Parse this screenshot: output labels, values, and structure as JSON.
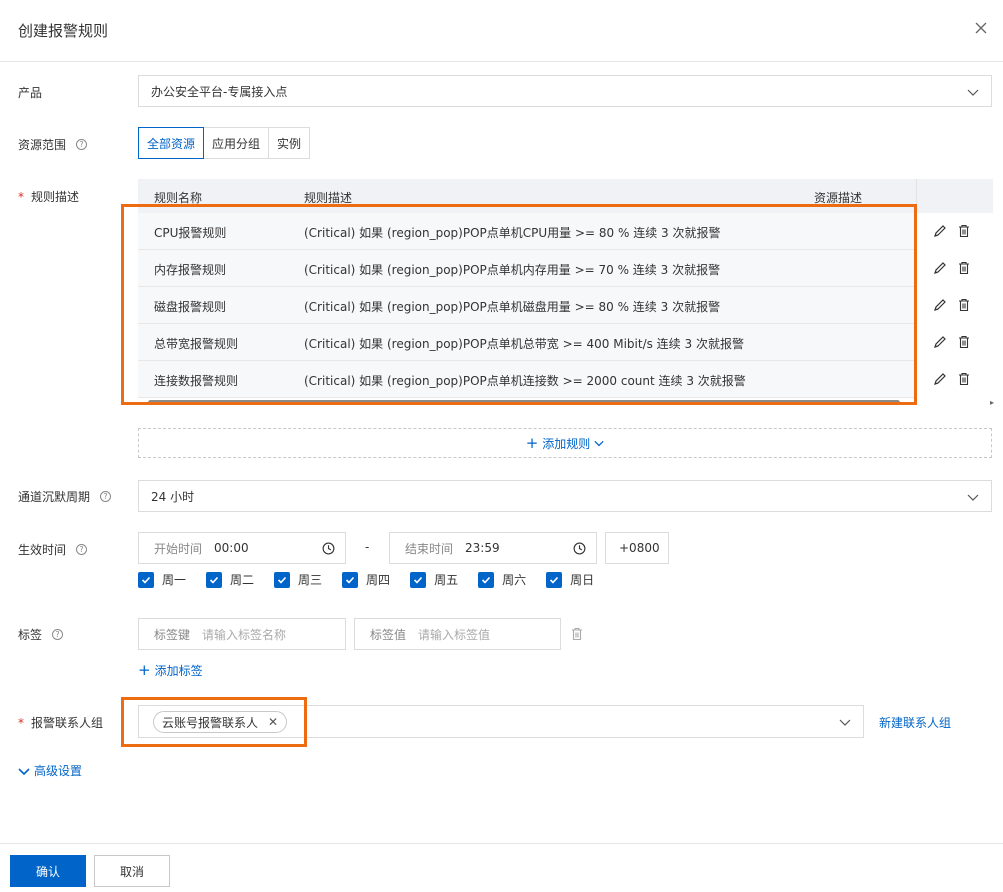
{
  "dialog": {
    "title": "创建报警规则"
  },
  "product": {
    "label": "产品",
    "value": "办公安全平台-专属接入点"
  },
  "resource_scope": {
    "label": "资源范围",
    "options": [
      "全部资源",
      "应用分组",
      "实例"
    ],
    "selected": "全部资源"
  },
  "rules": {
    "label": "规则描述",
    "headers": [
      "规则名称",
      "规则描述",
      "资源描述"
    ],
    "rows": [
      {
        "name": "CPU报警规则",
        "desc": "(Critical) 如果 (region_pop)POP点单机CPU用量 >= 80 % 连续 3 次就报警"
      },
      {
        "name": "内存报警规则",
        "desc": "(Critical) 如果 (region_pop)POP点单机内存用量 >= 70 % 连续 3 次就报警"
      },
      {
        "name": "磁盘报警规则",
        "desc": "(Critical) 如果 (region_pop)POP点单机磁盘用量 >= 80 % 连续 3 次就报警"
      },
      {
        "name": "总带宽报警规则",
        "desc": "(Critical) 如果 (region_pop)POP点单机总带宽 >= 400 Mibit/s 连续 3 次就报警"
      },
      {
        "name": "连接数报警规则",
        "desc": "(Critical) 如果 (region_pop)POP点单机连接数 >= 2000 count 连续 3 次就报警"
      }
    ],
    "add_label": "添加规则"
  },
  "silence": {
    "label": "通道沉默周期",
    "value": "24 小时"
  },
  "effective": {
    "label": "生效时间",
    "start_placeholder": "开始时间",
    "start_value": "00:00",
    "sep": "-",
    "end_placeholder": "结束时间",
    "end_value": "23:59",
    "timezone": "+0800",
    "days": [
      "周一",
      "周二",
      "周三",
      "周四",
      "周五",
      "周六",
      "周日"
    ]
  },
  "tags": {
    "label": "标签",
    "key_label": "标签键",
    "key_placeholder": "请输入标签名称",
    "value_label": "标签值",
    "value_placeholder": "请输入标签值",
    "add_label": "添加标签"
  },
  "contacts": {
    "label": "报警联系人组",
    "chip": "云账号报警联系人",
    "new_link": "新建联系人组"
  },
  "advanced": {
    "label": "高级设置"
  },
  "footer": {
    "confirm": "确认",
    "cancel": "取消"
  },
  "colors": {
    "primary": "#0064c8",
    "highlight": "#ed6c12",
    "required": "#d93026"
  }
}
